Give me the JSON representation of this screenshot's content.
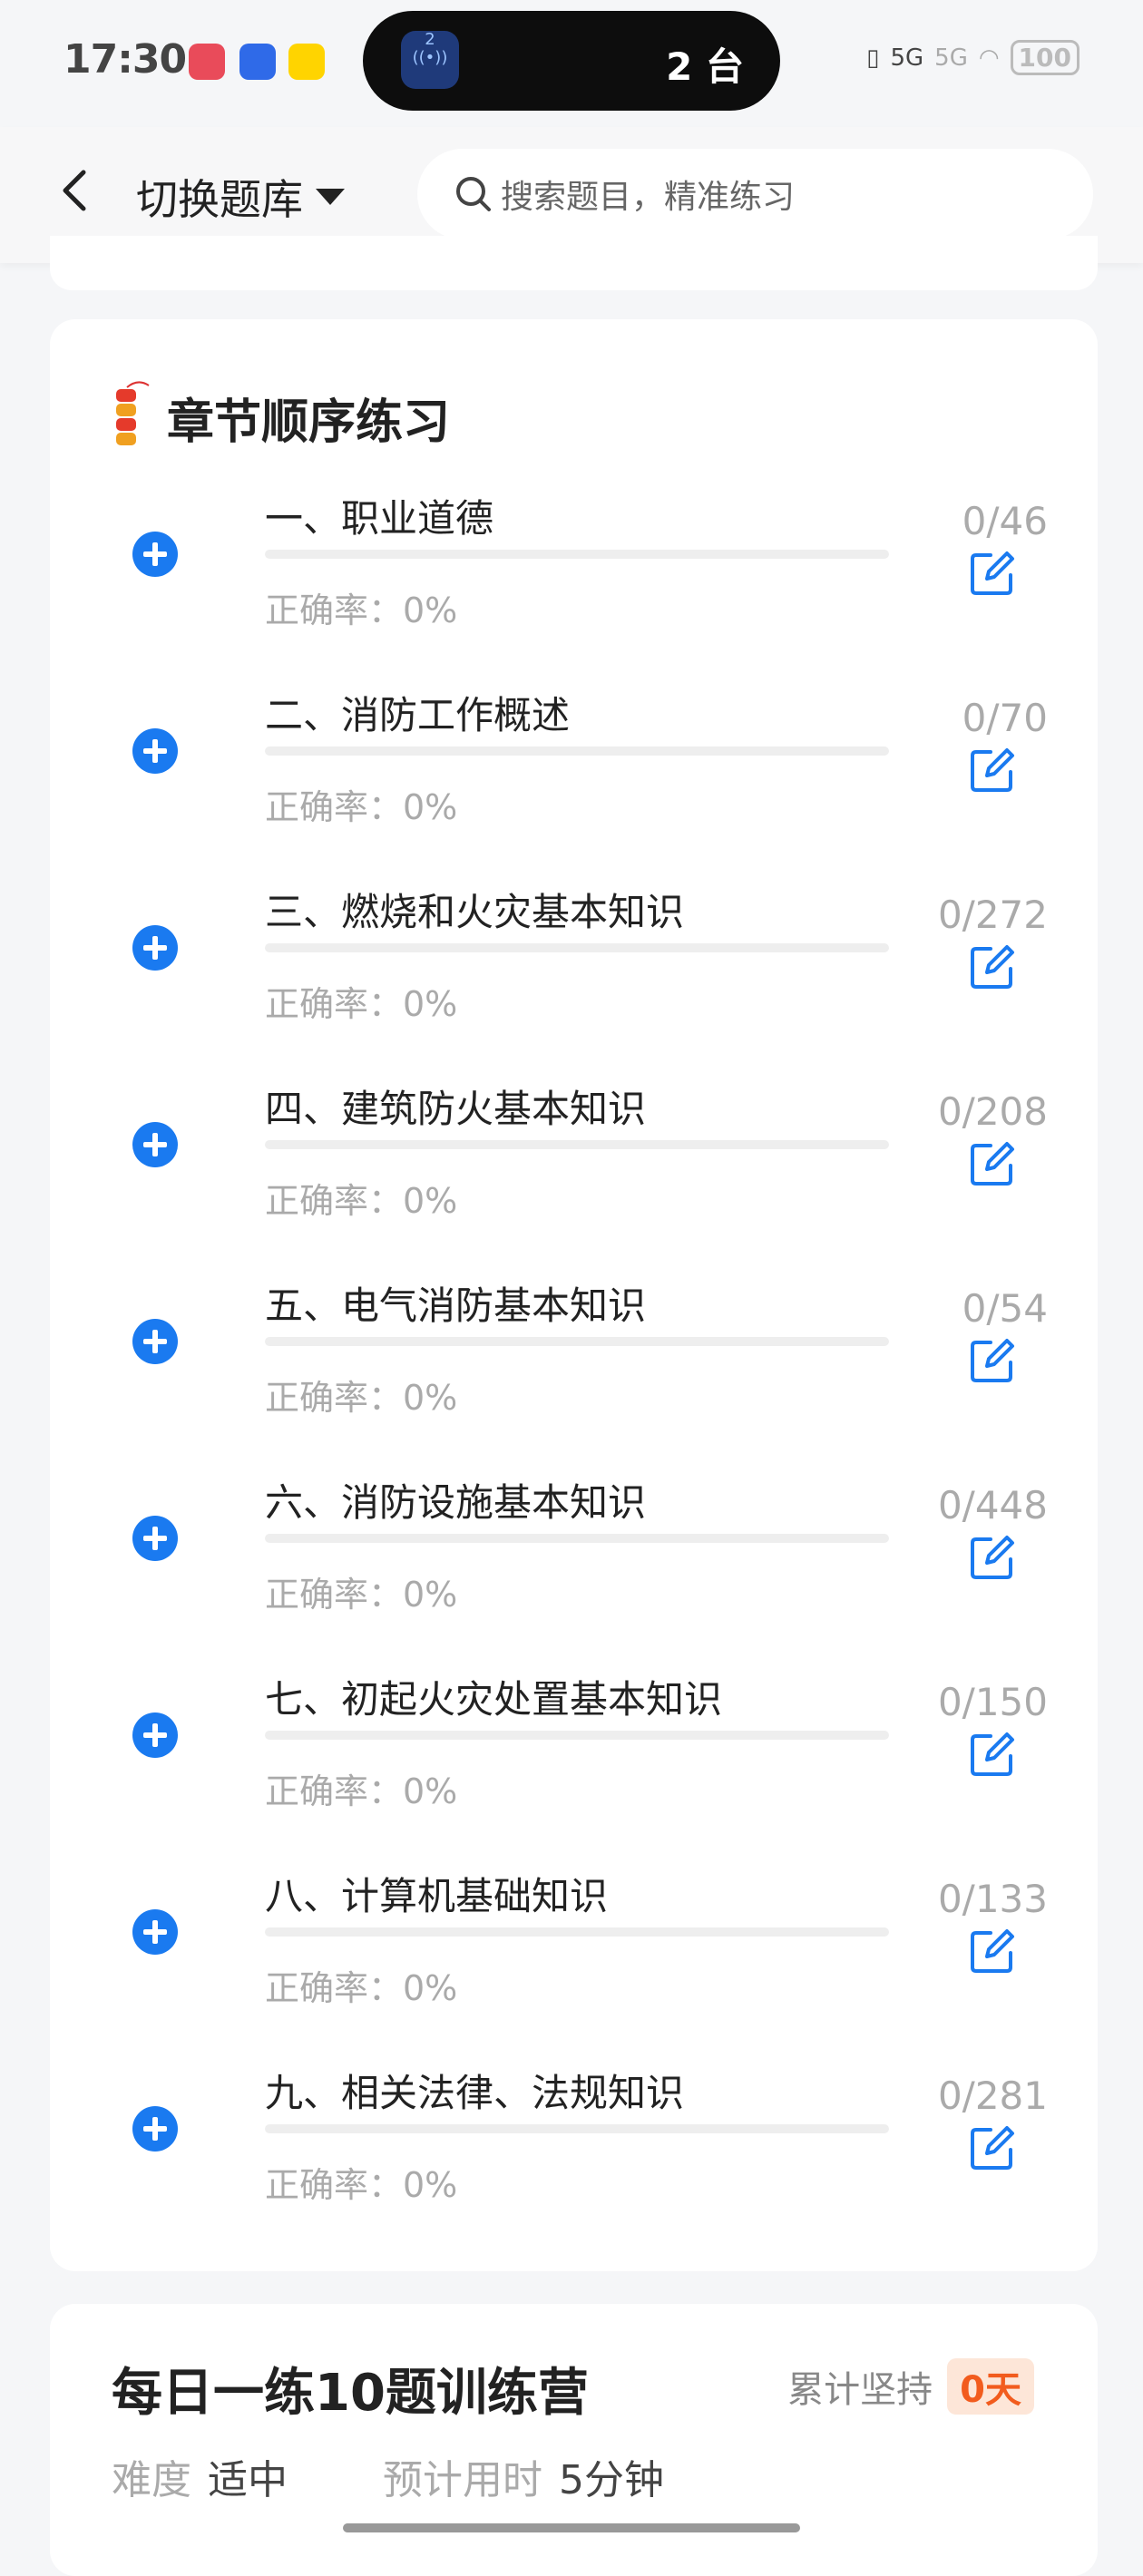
{
  "status_bar": {
    "time": "17:30",
    "island_badge": "2",
    "island_text": "2 台",
    "network": "5G",
    "network2": "5G",
    "battery": "100"
  },
  "nav": {
    "switch_label": "切换题库",
    "search_placeholder": "搜索题目，精准练习"
  },
  "chapter_section": {
    "title": "章节顺序练习",
    "chapters": [
      {
        "name": "一、职业道德",
        "accuracy": "正确率：0%",
        "count": "0/46"
      },
      {
        "name": "二、消防工作概述",
        "accuracy": "正确率：0%",
        "count": "0/70"
      },
      {
        "name": "三、燃烧和火灾基本知识",
        "accuracy": "正确率：0%",
        "count": "0/272"
      },
      {
        "name": "四、建筑防火基本知识",
        "accuracy": "正确率：0%",
        "count": "0/208"
      },
      {
        "name": "五、电气消防基本知识",
        "accuracy": "正确率：0%",
        "count": "0/54"
      },
      {
        "name": "六、消防设施基本知识",
        "accuracy": "正确率：0%",
        "count": "0/448"
      },
      {
        "name": "七、初起火灾处置基本知识",
        "accuracy": "正确率：0%",
        "count": "0/150"
      },
      {
        "name": "八、计算机基础知识",
        "accuracy": "正确率：0%",
        "count": "0/133"
      },
      {
        "name": "九、相关法律、法规知识",
        "accuracy": "正确率：0%",
        "count": "0/281"
      }
    ]
  },
  "daily_camp": {
    "title": "每日一练10题训练营",
    "persist_label": "累计坚持",
    "persist_value": "0天",
    "difficulty_label": "难度",
    "difficulty_value": "适中",
    "time_label": "预计用时",
    "time_value": "5分钟"
  },
  "colors": {
    "accent": "#1a7af0",
    "badge_bg": "#fde6d8",
    "badge_text": "#f25c1e"
  }
}
